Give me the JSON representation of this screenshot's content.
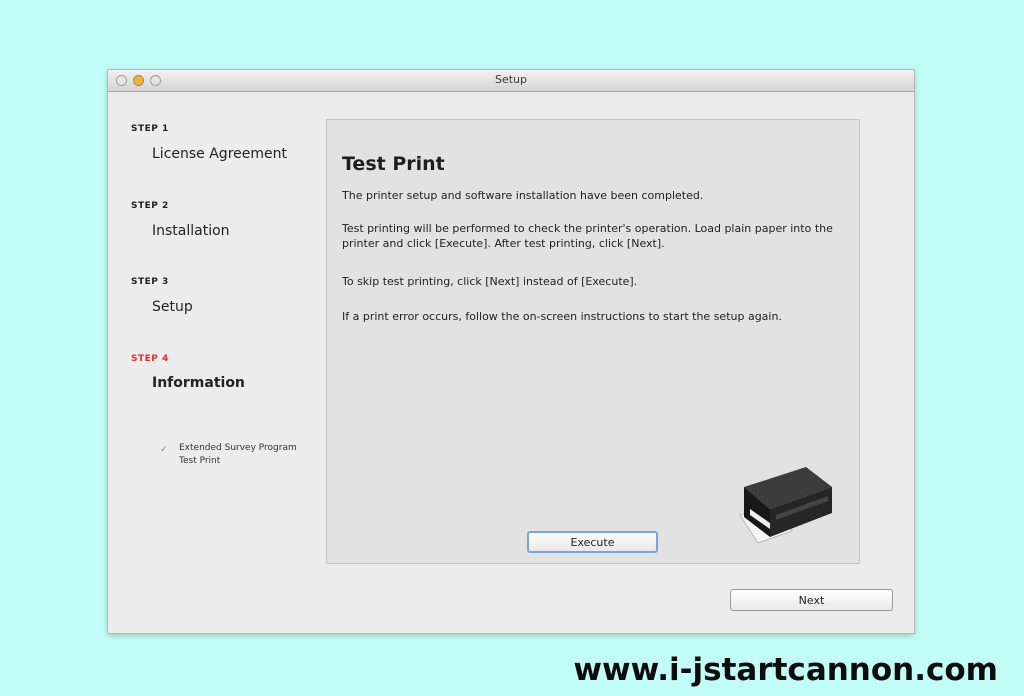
{
  "window": {
    "title": "Setup"
  },
  "steps": [
    {
      "num": "STEP 1",
      "name": "License Agreement",
      "active": false
    },
    {
      "num": "STEP 2",
      "name": "Installation",
      "active": false
    },
    {
      "num": "STEP 3",
      "name": "Setup",
      "active": false
    },
    {
      "num": "STEP 4",
      "name": "Information",
      "active": true
    }
  ],
  "substeps": [
    "Extended Survey Program",
    "Test Print"
  ],
  "content": {
    "heading": "Test Print",
    "paragraphs": [
      "The printer setup and software installation have been completed.",
      "Test printing will be performed to check the printer's operation. Load plain paper into the printer and click [Execute]. After test printing, click [Next].",
      "To skip test printing, click [Next] instead of [Execute].",
      "If a print error occurs, follow the on-screen instructions to start the setup again."
    ],
    "execute_label": "Execute"
  },
  "next_label": "Next",
  "watermark": "www.i-jstartcannon.com",
  "colors": {
    "background": "#c2fcf6",
    "active_step": "#e03030",
    "window": "#ececec",
    "panel": "#e2e2e2"
  },
  "icons": {
    "substep_check": "checkmark-icon",
    "illustration": "printer-icon"
  }
}
